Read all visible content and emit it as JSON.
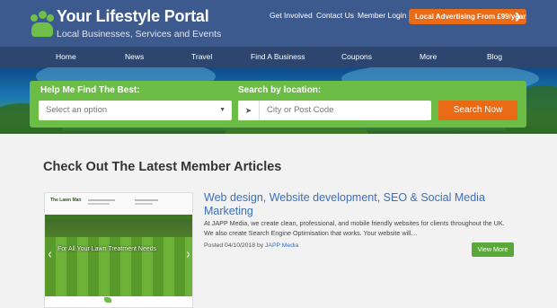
{
  "brand": {
    "title": "Your Lifestyle Portal",
    "subtitle": "Local Businesses, Services and Events",
    "logo_icon": "people-group-icon",
    "color": "#6fc04b"
  },
  "top_links": [
    "Get Involved",
    "Contact Us",
    "Member Login"
  ],
  "advertising": {
    "label": "Local Advertising From £99/year",
    "icon": "chevron-right-icon",
    "color": "#ea6b16"
  },
  "nav": [
    "Home",
    "News",
    "Travel",
    "Find A Business",
    "Coupons",
    "More",
    "Blog"
  ],
  "search": {
    "find_label": "Help Me Find The Best:",
    "select_value": "Select an option",
    "location_label": "Search by location:",
    "location_placeholder": "City or Post Code",
    "location_icon": "location-arrow-icon",
    "button_label": "Search Now"
  },
  "section_title": "Check Out The Latest Member Articles",
  "article": {
    "title": "Web design, Website development, SEO & Social Media Marketing",
    "body": "At JAPP Media, we create clean, professional, and mobile friendly websites for clients throughout the UK. We also create Search Engine Optimisation that works. Your website will…",
    "posted_prefix": "Posted 04/10/2018 by ",
    "author": "JAPP Media",
    "button_label": "View More",
    "thumbnail": {
      "logo_text": "The Lawn Man",
      "caption": "For All Your Lawn Treatment Needs"
    }
  }
}
